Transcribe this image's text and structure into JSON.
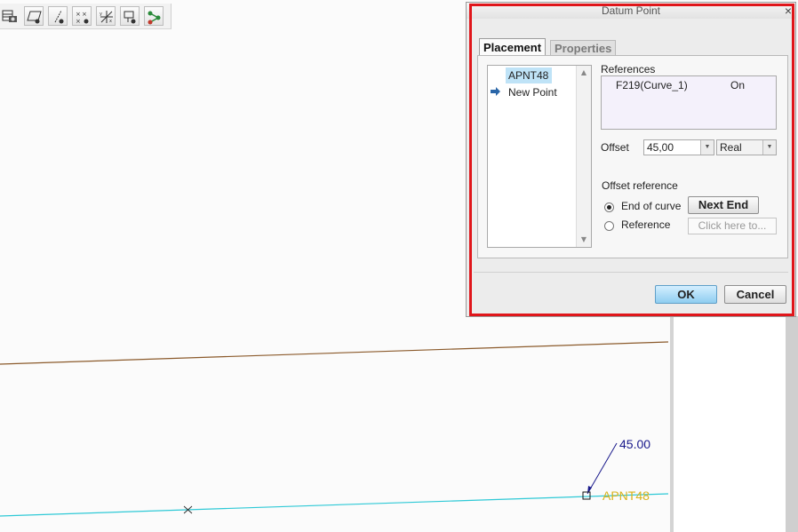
{
  "toolbar": {
    "icons": [
      "layer-camera-icon",
      "datum-plane-display-icon",
      "datum-axis-display-icon",
      "datum-point-display-icon",
      "csys-display-icon",
      "annotation-display-icon",
      "network-icon"
    ]
  },
  "graphics": {
    "dimension_value": "45.00",
    "point_label": "APNT48",
    "colors": {
      "upper_curve": "#8b5a2b",
      "lower_curve": "#2ec9d6",
      "dimension": "#1a1a8c",
      "point_label": "#d9b21a"
    }
  },
  "dialog": {
    "title": "Datum Point",
    "close": "×",
    "tabs": [
      "Placement",
      "Properties"
    ],
    "points_list": [
      "APNT48",
      "New Point"
    ],
    "references_label": "References",
    "reference_row": {
      "name": "F219(Curve_1)",
      "type": "On"
    },
    "offset_label": "Offset",
    "offset_value": "45,00",
    "offset_type": "Real",
    "offset_reference_label": "Offset reference",
    "end_of_curve_label": "End of curve",
    "next_end_label": "Next End",
    "reference_label": "Reference",
    "click_here_placeholder": "Click here to...",
    "ok_label": "OK",
    "cancel_label": "Cancel",
    "highlight_color": "#e0161b"
  }
}
